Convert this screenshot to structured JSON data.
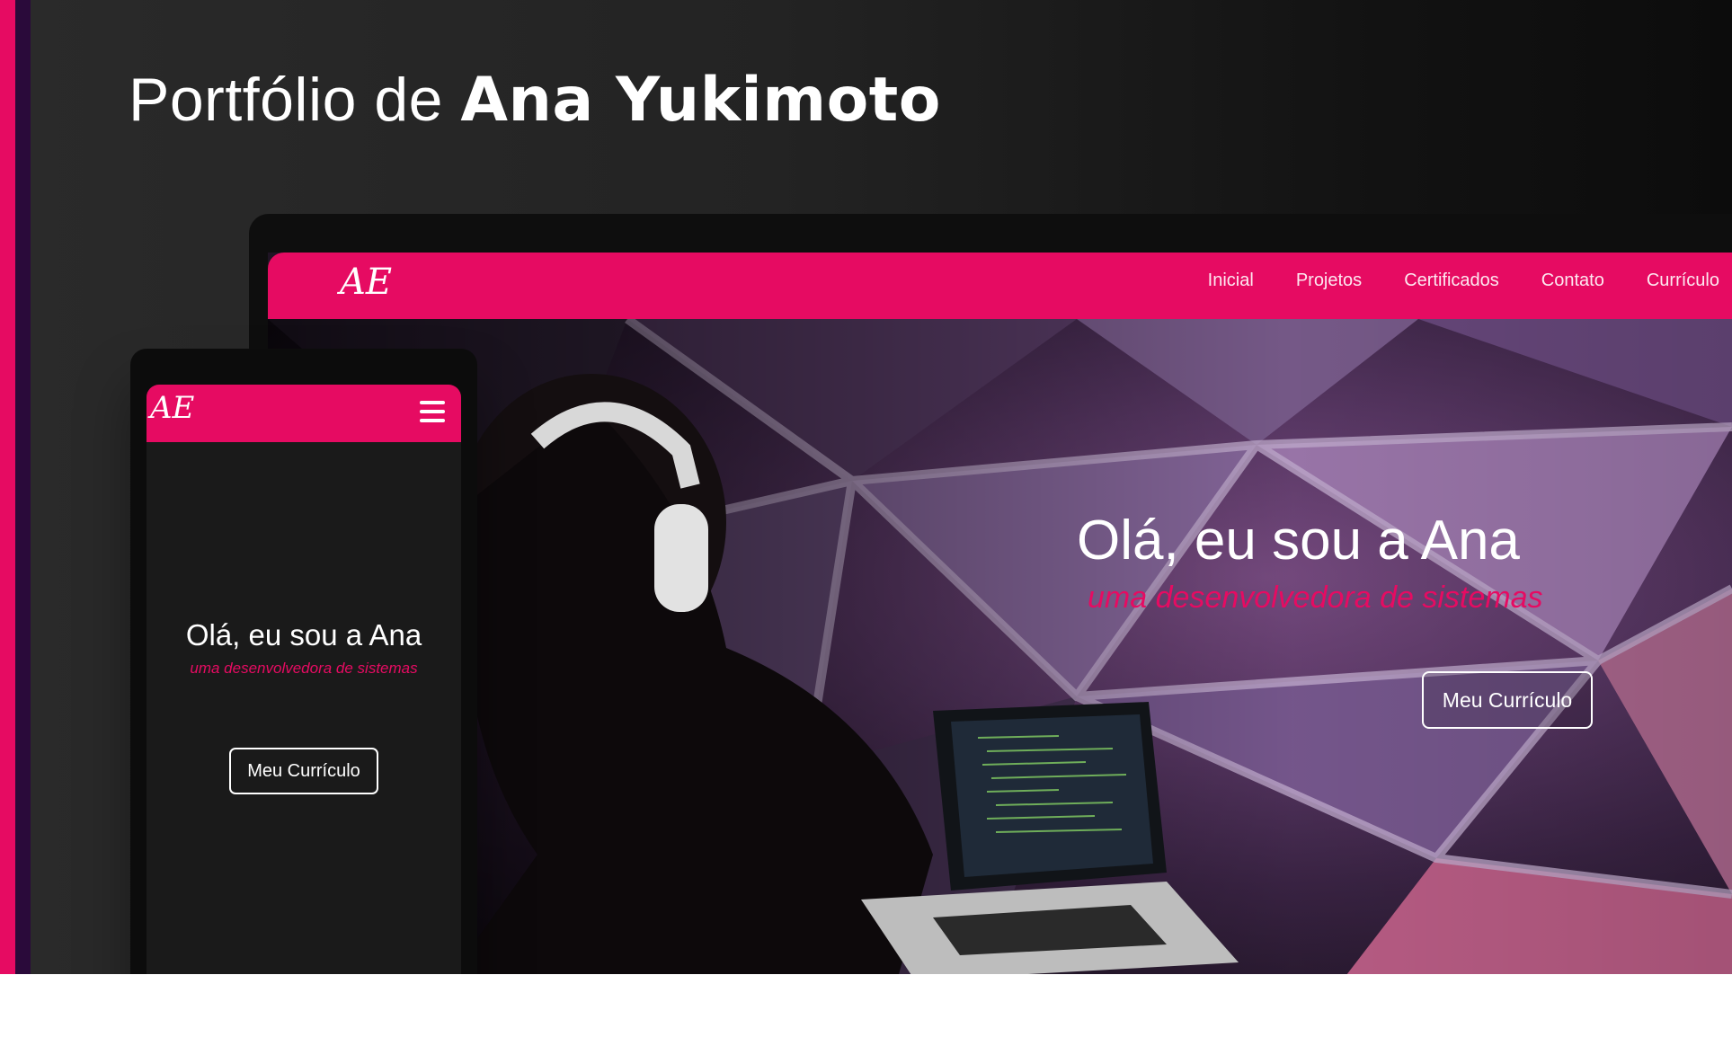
{
  "headline": {
    "prefix": "Portfólio de ",
    "name": "Ana Yukimoto"
  },
  "desktop": {
    "logo": "AE",
    "nav": [
      "Inicial",
      "Projetos",
      "Certificados",
      "Contato",
      "Currículo"
    ],
    "hero_title": "Olá, eu sou a Ana",
    "hero_subtitle": "uma desenvolvedora de sistemas",
    "cta": "Meu Currículo"
  },
  "mobile": {
    "logo": "AE",
    "hero_title": "Olá, eu sou a Ana",
    "hero_subtitle": "uma desenvolvedora de sistemas",
    "cta": "Meu Currículo"
  },
  "colors": {
    "accent": "#e60b62",
    "accent_dark": "#2a0a3a",
    "background": "#222222"
  },
  "icons": {
    "menu": "hamburger-menu-icon"
  }
}
